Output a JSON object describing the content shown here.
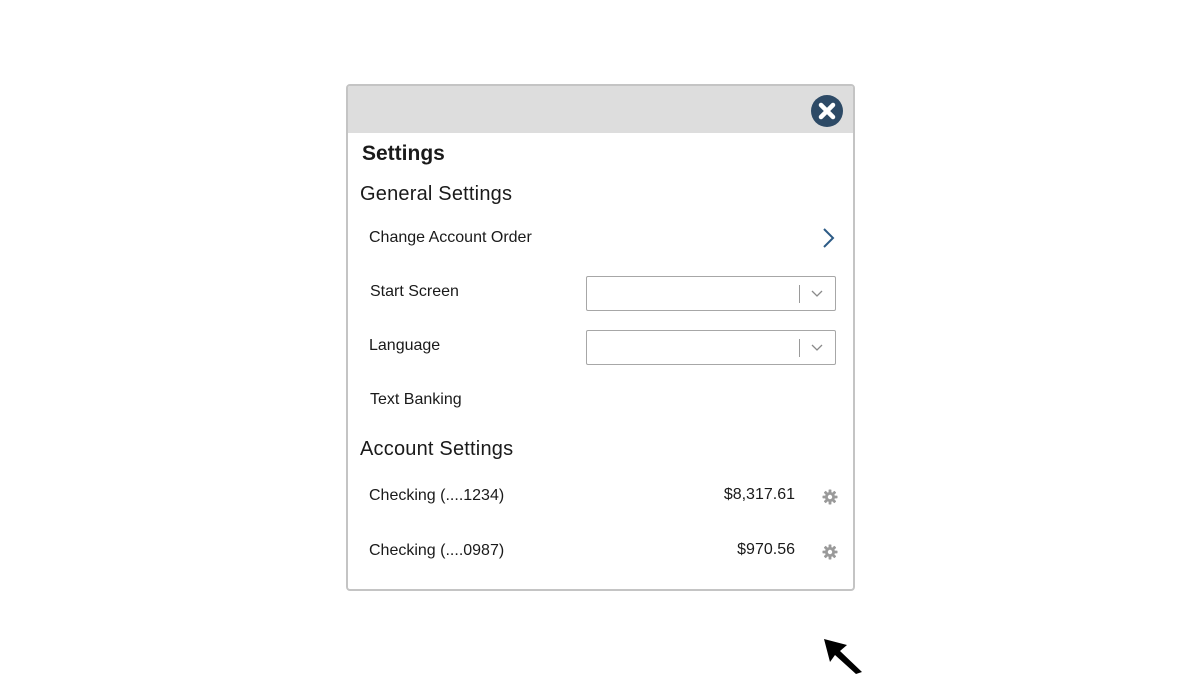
{
  "dialog": {
    "title": "Settings",
    "close_icon": "close-circle-icon"
  },
  "general_settings": {
    "heading": "General Settings",
    "change_account_order": {
      "label": "Change Account Order",
      "icon": "chevron-right-icon"
    },
    "start_screen": {
      "label": "Start Screen",
      "selected_value": "",
      "icon": "chevron-down-icon"
    },
    "language": {
      "label": "Language",
      "selected_value": "",
      "icon": "chevron-down-icon"
    },
    "text_banking": {
      "label": "Text Banking"
    }
  },
  "account_settings": {
    "heading": "Account Settings",
    "accounts": [
      {
        "name": "Checking (....1234)",
        "balance": "$8,317.61",
        "icon": "gear-icon"
      },
      {
        "name": "Checking (....0987)",
        "balance": "$970.56",
        "icon": "gear-icon"
      }
    ]
  },
  "colors": {
    "titlebar": "#dddddd",
    "close_button": "#2d4a66",
    "chevron_accent": "#2d5b86",
    "gear": "#9a9a9a",
    "border": "#c4c4c4"
  },
  "cursor": {
    "icon": "mouse-pointer-icon"
  }
}
